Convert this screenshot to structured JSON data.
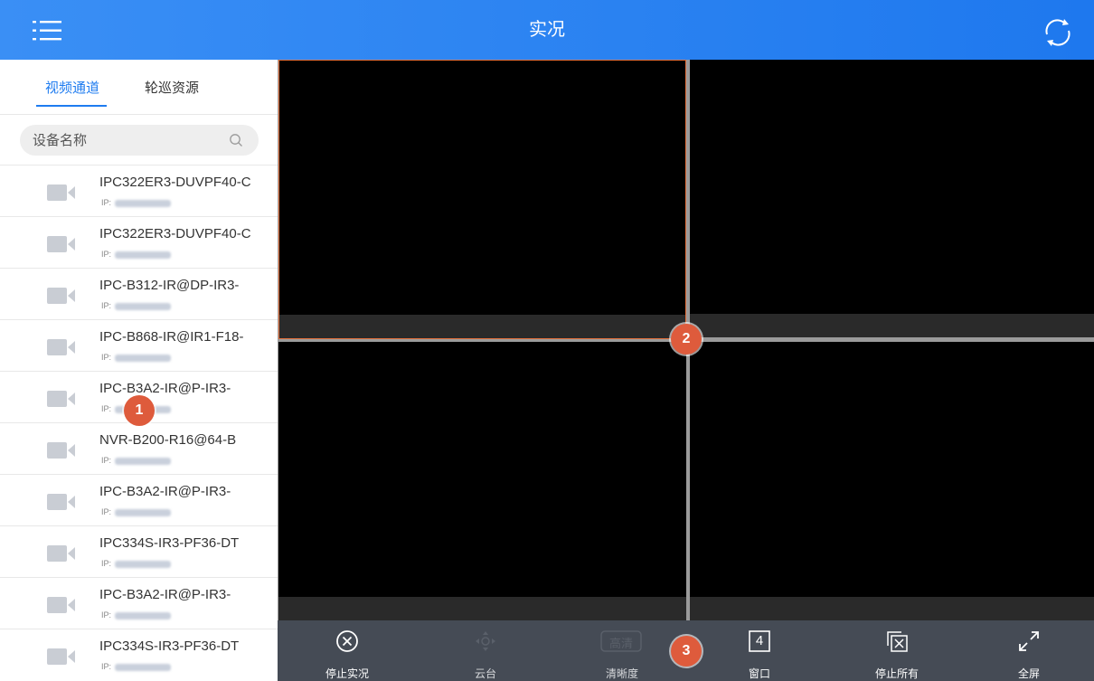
{
  "header": {
    "title": "实况",
    "menu_icon": "menu-list-icon",
    "refresh_icon": "refresh-icon",
    "bg_color": "#2a84f2"
  },
  "sidebar": {
    "tabs": [
      {
        "label": "视频通道",
        "active": true
      },
      {
        "label": "轮巡资源",
        "active": false
      }
    ],
    "search": {
      "placeholder": "设备名称"
    },
    "ip_prefix": "IP:",
    "devices": [
      {
        "name": "IPC322ER3-DUVPF40-C"
      },
      {
        "name": "IPC322ER3-DUVPF40-C"
      },
      {
        "name": "IPC-B312-IR@DP-IR3-"
      },
      {
        "name": "IPC-B868-IR@IR1-F18-"
      },
      {
        "name": "IPC-B3A2-IR@P-IR3-"
      },
      {
        "name": "NVR-B200-R16@64-B"
      },
      {
        "name": "IPC-B3A2-IR@P-IR3-"
      },
      {
        "name": "IPC334S-IR3-PF36-DT"
      },
      {
        "name": "IPC-B3A2-IR@P-IR3-"
      },
      {
        "name": "IPC334S-IR3-PF36-DT"
      }
    ]
  },
  "grid": {
    "panes": 4,
    "selected_pane": 1,
    "selected_color": "#e4703c"
  },
  "toolbar": {
    "items": [
      {
        "label": "停止实况",
        "icon": "stop-circle-icon",
        "enabled": true
      },
      {
        "label": "云台",
        "icon": "ptz-icon",
        "enabled": false
      },
      {
        "label": "清晰度",
        "icon": "hd-quality-icon",
        "enabled": false
      },
      {
        "label": "窗口",
        "icon": "window-layout-icon",
        "enabled": true,
        "value": "4"
      },
      {
        "label": "停止所有",
        "icon": "stop-all-icon",
        "enabled": true
      },
      {
        "label": "全屏",
        "icon": "fullscreen-icon",
        "enabled": true
      }
    ],
    "quality_badge": "高清"
  },
  "callouts": [
    "1",
    "2",
    "3"
  ],
  "accent_color": "#1f7cf0",
  "callout_color": "#de5b3c"
}
